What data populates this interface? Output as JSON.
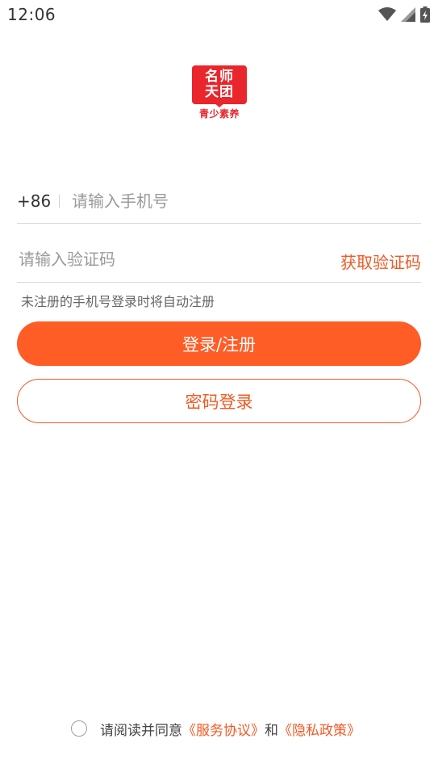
{
  "status_bar": {
    "time": "12:06",
    "icons": [
      "wifi-icon",
      "cell-signal-icon",
      "battery-charging-icon"
    ]
  },
  "logo": {
    "line1": "名师",
    "line2": "天团",
    "subtitle": "青少素养",
    "color": "#e8262c"
  },
  "phone": {
    "country_code": "+86",
    "placeholder": "请输入手机号",
    "value": ""
  },
  "code": {
    "placeholder": "请输入验证码",
    "value": "",
    "get_code_label": "获取验证码"
  },
  "hint": "未注册的手机号登录时将自动注册",
  "buttons": {
    "login_register": "登录/注册",
    "password_login": "密码登录"
  },
  "agreement": {
    "checked": false,
    "prefix": "请阅读并同意",
    "service_link": "《服务协议》",
    "conjunction": "和",
    "privacy_link": "《隐私政策》"
  },
  "colors": {
    "accent": "#ff5c26",
    "link": "#f05a24"
  }
}
